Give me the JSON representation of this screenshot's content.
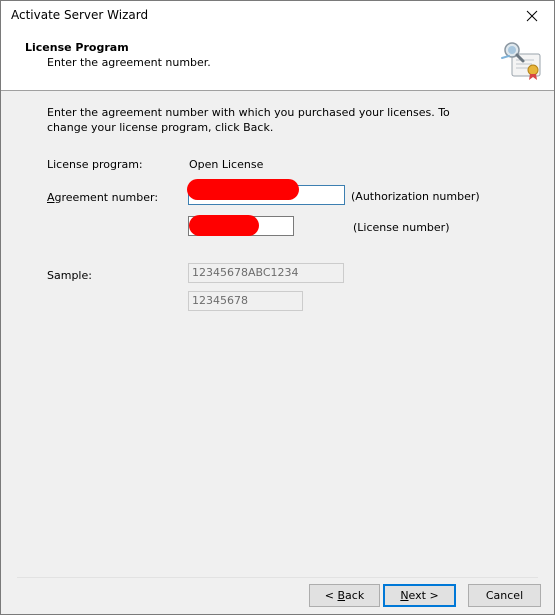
{
  "window": {
    "title": "Activate Server Wizard"
  },
  "header": {
    "title": "License Program",
    "subtitle": "Enter the agreement number."
  },
  "content": {
    "intro": "Enter the agreement number with which you purchased your licenses. To change your license program, click Back.",
    "license_program_label": "License program:",
    "license_program_value": "Open License",
    "agreement_label_access_key": "A",
    "agreement_label_rest": "greement number:",
    "authorization_value": "",
    "authorization_caption": "(Authorization number)",
    "license_number_value": "",
    "license_number_caption": "(License number)",
    "sample_label": "Sample:",
    "sample_authorization": "12345678ABC1234",
    "sample_license": "12345678"
  },
  "footer": {
    "back_prefix": "< ",
    "back_key": "B",
    "back_rest": "ack",
    "next_key": "N",
    "next_rest": "ext >",
    "cancel_label": "Cancel"
  },
  "colors": {
    "redaction": "#ff0000",
    "focus_border": "#3c7fb1",
    "default_button_border": "#0078d7"
  },
  "icons": {
    "close": "close-icon",
    "header": "certificate-icon"
  }
}
